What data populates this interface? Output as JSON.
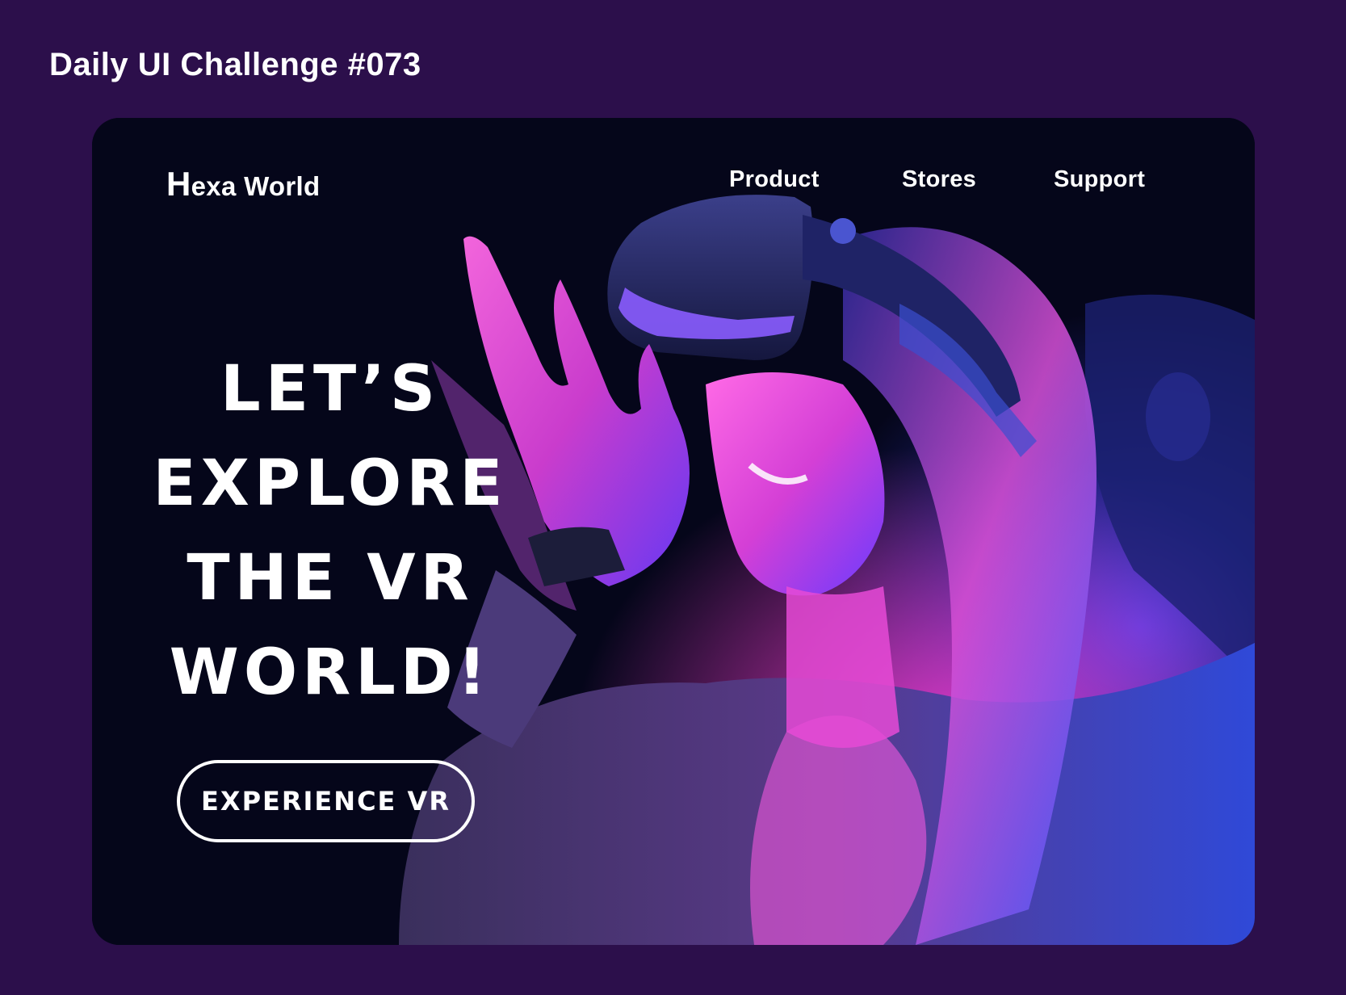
{
  "page": {
    "heading": "Daily UI Challenge #073"
  },
  "brand": {
    "initial": "H",
    "rest": "exa World"
  },
  "nav": {
    "items": [
      {
        "label": "Product"
      },
      {
        "label": "Stores"
      },
      {
        "label": "Support"
      }
    ]
  },
  "hero": {
    "headline_lines": [
      "LET’S",
      "EXPLORE",
      "THE VR",
      "WORLD!"
    ],
    "cta_label": "EXPERIENCE VR",
    "image_icon": "woman-wearing-vr-headset-photo"
  },
  "colors": {
    "page_background": "#2c0f4b",
    "card_background": "#05061a",
    "neon_magenta": "#e040fb",
    "neon_blue": "#3d3dff",
    "text": "#ffffff"
  }
}
